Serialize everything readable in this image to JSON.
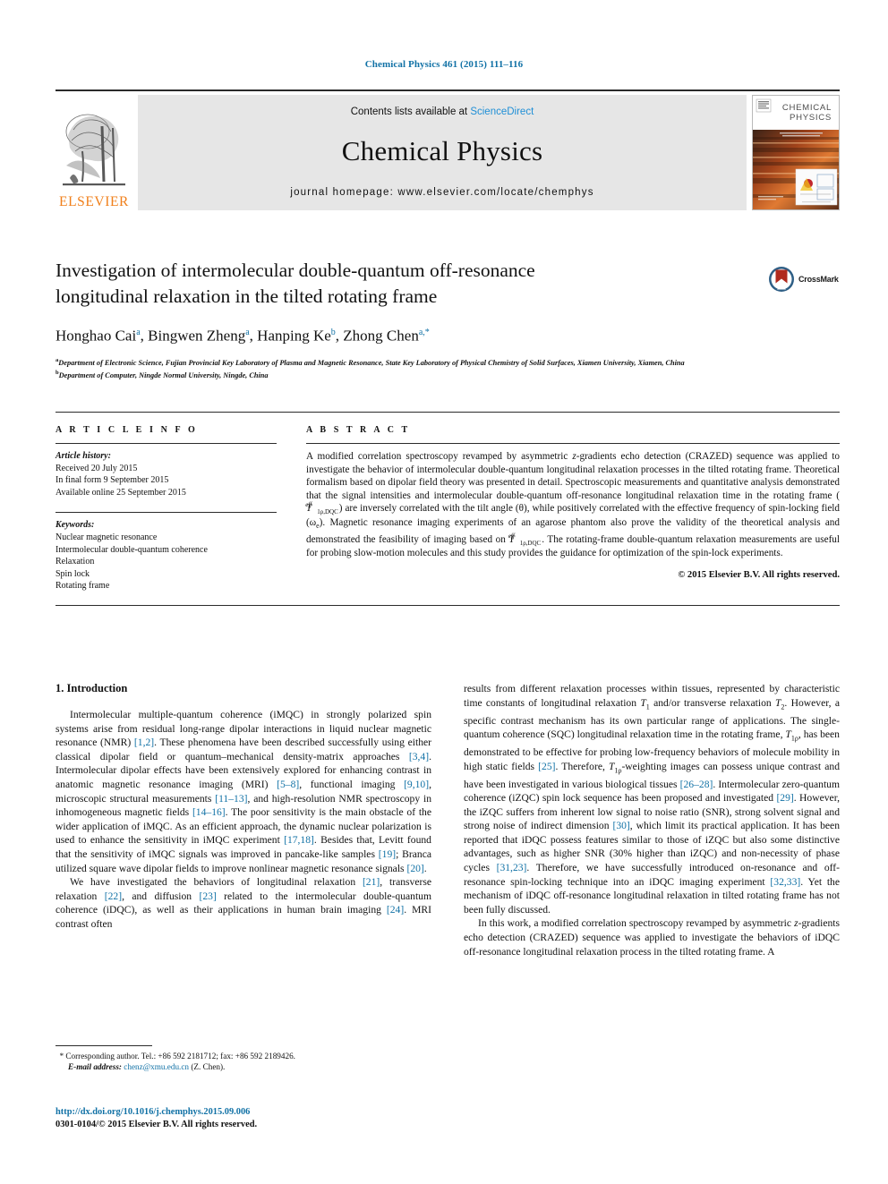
{
  "running_head": "Chemical Physics 461 (2015) 111–116",
  "masthead": {
    "publisher_name": "ELSEVIER",
    "contents_prefix": "Contents lists available at ",
    "contents_link": "ScienceDirect",
    "journal_title": "Chemical Physics",
    "homepage": "journal homepage: www.elsevier.com/locate/chemphys",
    "cover_title_line1": "CHEMICAL",
    "cover_title_line2": "PHYSICS"
  },
  "article": {
    "title_line1": "Investigation of intermolecular double-quantum off-resonance",
    "title_line2": "longitudinal relaxation in the tilted rotating frame",
    "authors": [
      {
        "name": "Honghao Cai",
        "sup": "a",
        "sep": ", "
      },
      {
        "name": "Bingwen Zheng",
        "sup": "a",
        "sep": ", "
      },
      {
        "name": "Hanping Ke",
        "sup": "b",
        "sep": ", "
      },
      {
        "name": "Zhong Chen",
        "sup": "a,*",
        "sep": ""
      }
    ],
    "affiliations": [
      {
        "mark": "a",
        "text": "Department of Electronic Science, Fujian Provincial Key Laboratory of Plasma and Magnetic Resonance, State Key Laboratory of Physical Chemistry of Solid Surfaces, Xiamen University, Xiamen, China"
      },
      {
        "mark": "b",
        "text": "Department of Computer, Ningde Normal University, Ningde, China"
      }
    ],
    "crossmark_label": "CrossMark"
  },
  "article_info": {
    "heading": "A R T I C L E    I N F O",
    "history_label": "Article history:",
    "history": [
      "Received 20 July 2015",
      "In final form 9 September 2015",
      "Available online 25 September 2015"
    ],
    "keywords_label": "Keywords:",
    "keywords": [
      "Nuclear magnetic resonance",
      "Intermolecular double-quantum coherence",
      "Relaxation",
      "Spin lock",
      "Rotating frame"
    ]
  },
  "abstract": {
    "heading": "A B S T R A C T",
    "part1": "A modified correlation spectroscopy revamped by asymmetric ",
    "zgrad": "z",
    "part2": "-gradients echo detection (CRAZED) sequence was applied to investigate the behavior of intermolecular double-quantum longitudinal relaxation processes in the tilted rotating frame. Theoretical formalism based on dipolar field theory was presented in detail. Spectroscopic measurements and quantitative analysis demonstrated that the signal intensities and intermolecular double-quantum off-resonance longitudinal relaxation time in the rotating frame (",
    "sym1_base": "T",
    "sym1_sub": "1ρ,DQC",
    "sym1_sup": "eff",
    "part3": ") are inversely correlated with the tilt angle (θ), while positively correlated with the effective frequency of spin-locking field (ω",
    "part3_sub": "e",
    "part4": "). Magnetic resonance imaging experiments of an agarose phantom also prove the validity of the theoretical analysis and demonstrated the feasibility of imaging based on ",
    "sym2_base": "T",
    "sym2_sub": "1ρ,DQC",
    "sym2_sup": "eff",
    "part5": ". The rotating-frame double-quantum relaxation measurements are useful for probing slow-motion molecules and this study provides the guidance for optimization of the spin-lock experiments.",
    "copyright": "© 2015 Elsevier B.V. All rights reserved."
  },
  "body": {
    "section_number_title": "1. Introduction",
    "left_paragraphs": [
      {
        "segments": [
          {
            "t": "Intermolecular multiple-quantum coherence (iMQC) in strongly polarized spin systems arise from residual long-range dipolar interactions in liquid nuclear magnetic resonance (NMR) "
          },
          {
            "t": "[1,2]",
            "k": "ref"
          },
          {
            "t": ". These phenomena have been described successfully using either classical dipolar field or quantum–mechanical density-matrix approaches "
          },
          {
            "t": "[3,4]",
            "k": "ref"
          },
          {
            "t": ". Intermolecular dipolar effects have been extensively explored for enhancing contrast in anatomic magnetic resonance imaging (MRI) "
          },
          {
            "t": "[5–8]",
            "k": "ref"
          },
          {
            "t": ", functional imaging "
          },
          {
            "t": "[9,10]",
            "k": "ref"
          },
          {
            "t": ", microscopic structural measurements "
          },
          {
            "t": "[11–13]",
            "k": "ref"
          },
          {
            "t": ", and high-resolution NMR spectroscopy in inhomogeneous magnetic fields "
          },
          {
            "t": "[14–16]",
            "k": "ref"
          },
          {
            "t": ". The poor sensitivity is the main obstacle of the wider application of iMQC. As an efficient approach, the dynamic nuclear polarization is used to enhance the sensitivity in iMQC experiment "
          },
          {
            "t": "[17,18]",
            "k": "ref"
          },
          {
            "t": ". Besides that, Levitt found that the sensitivity of iMQC signals was improved in pancake-like samples "
          },
          {
            "t": "[19]",
            "k": "ref"
          },
          {
            "t": "; Branca utilized square wave dipolar fields to improve nonlinear magnetic resonance signals "
          },
          {
            "t": "[20]",
            "k": "ref"
          },
          {
            "t": "."
          }
        ]
      },
      {
        "segments": [
          {
            "t": "We have investigated the behaviors of longitudinal relaxation "
          },
          {
            "t": "[21]",
            "k": "ref"
          },
          {
            "t": ", transverse relaxation "
          },
          {
            "t": "[22]",
            "k": "ref"
          },
          {
            "t": ", and diffusion "
          },
          {
            "t": "[23]",
            "k": "ref"
          },
          {
            "t": " related to the intermolecular double-quantum coherence (iDQC), as well as their applications in human brain imaging "
          },
          {
            "t": "[24]",
            "k": "ref"
          },
          {
            "t": ". MRI contrast often"
          }
        ]
      }
    ],
    "right_paragraphs": [
      {
        "noindent": true,
        "segments": [
          {
            "t": "results from different relaxation processes within tissues, represented by characteristic time constants of longitudinal relaxation "
          },
          {
            "t": "T",
            "k": "it"
          },
          {
            "t": "1",
            "k": "sub"
          },
          {
            "t": " and/or transverse relaxation "
          },
          {
            "t": "T",
            "k": "it"
          },
          {
            "t": "2",
            "k": "sub"
          },
          {
            "t": ". However, a specific contrast mechanism has its own particular range of applications. The single-quantum coherence (SQC) longitudinal relaxation time in the rotating frame, "
          },
          {
            "t": "T",
            "k": "it"
          },
          {
            "t": "1ρ",
            "k": "sub"
          },
          {
            "t": ", has been demonstrated to be effective for probing low-frequency behaviors of molecule mobility in high static fields "
          },
          {
            "t": "[25]",
            "k": "ref"
          },
          {
            "t": ". Therefore, "
          },
          {
            "t": "T",
            "k": "it"
          },
          {
            "t": "1ρ",
            "k": "sub"
          },
          {
            "t": "-weighting images can possess unique contrast and have been investigated in various biological tissues "
          },
          {
            "t": "[26–28]",
            "k": "ref"
          },
          {
            "t": ". Intermolecular zero-quantum coherence (iZQC) spin lock sequence has been proposed and investigated "
          },
          {
            "t": "[29]",
            "k": "ref"
          },
          {
            "t": ". However, the iZQC suffers from inherent low signal to noise ratio (SNR), strong solvent signal and strong noise of indirect dimension "
          },
          {
            "t": "[30]",
            "k": "ref"
          },
          {
            "t": ", which limit its practical application. It has been reported that iDQC possess features similar to those of iZQC but also some distinctive advantages, such as higher SNR (30% higher than iZQC) and non-necessity of phase cycles "
          },
          {
            "t": "[31,23]",
            "k": "ref"
          },
          {
            "t": ". Therefore, we have successfully introduced on-resonance and off-resonance spin-locking technique into an iDQC imaging experiment "
          },
          {
            "t": "[32,33]",
            "k": "ref"
          },
          {
            "t": ". Yet the mechanism of iDQC off-resonance longitudinal relaxation in tilted rotating frame has not been fully discussed."
          }
        ]
      },
      {
        "segments": [
          {
            "t": "In this work, a modified correlation spectroscopy revamped by asymmetric "
          },
          {
            "t": "z",
            "k": "it"
          },
          {
            "t": "-gradients echo detection (CRAZED) sequence was applied to investigate the behaviors of iDQC off-resonance longitudinal relaxation process in the tilted rotating frame. A"
          }
        ]
      }
    ]
  },
  "footer": {
    "corresponding_star": "*",
    "corresponding_text": "Corresponding author. Tel.: +86 592 2181712; fax: +86 592 2189426.",
    "email_label": "E-mail address:",
    "email": "chenz@xmu.edu.cn",
    "email_suffix": "(Z. Chen).",
    "doi": "http://dx.doi.org/10.1016/j.chemphys.2015.09.006",
    "issn_line": "0301-0104/© 2015 Elsevier B.V. All rights reserved."
  },
  "colors": {
    "link": "#1272a6",
    "elsevier_orange": "#f07f1a",
    "band_gray": "#e6e6e6",
    "sciencedirect_blue": "#1f8fd6"
  }
}
